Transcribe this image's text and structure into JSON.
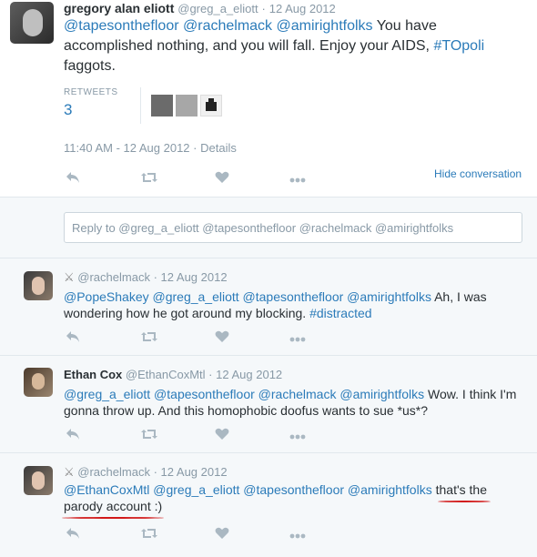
{
  "main_tweet": {
    "display_name": "gregory alan eliott",
    "handle": "@greg_a_eliott",
    "dot": "·",
    "date": "12 Aug 2012",
    "mentions": [
      "@tapesonthefloor",
      "@rachelmack",
      "@amirightfolks"
    ],
    "text_plain_1": "You have accomplished nothing, and you will fall. Enjoy your AIDS,",
    "hashtag": "#TOpoli",
    "text_plain_2": "faggots.",
    "retweets_label": "RETWEETS",
    "retweets_count": "3",
    "timestamp": "11:40 AM - 12 Aug 2012",
    "details_link": "Details",
    "hide_conversation": "Hide conversation"
  },
  "reply_box": {
    "placeholder": "Reply to @greg_a_eliott @tapesonthefloor @rachelmack @amirightfolks"
  },
  "replies": [
    {
      "handle": "@rachelmack",
      "date": "12 Aug 2012",
      "dot": "·",
      "line1_mentions": "@PopeShakey @greg_a_eliott @tapesonthefloor @amirightfolks",
      "line1_text": "Ah, I was",
      "line2_text": "wondering how he got around my blocking.",
      "line2_hashtag": "#distracted"
    },
    {
      "display_name": "Ethan Cox",
      "handle": "@EthanCoxMtl",
      "date": "12 Aug 2012",
      "dot": "·",
      "line1_mentions": "@greg_a_eliott @tapesonthefloor @rachelmack @amirightfolks",
      "line1_text": "Wow. I think I'm",
      "line2_text": "gonna throw up. And this homophobic doofus wants to sue *us*?"
    },
    {
      "handle": "@rachelmack",
      "date": "12 Aug 2012",
      "dot": "·",
      "line1_mentions": "@EthanCoxMtl @greg_a_eliott @tapesonthefloor @amirightfolks",
      "line1_text": "that's the",
      "line2_text": "parody account :)"
    }
  ],
  "colors": {
    "link": "#2b7bb9",
    "muted": "#8899a6",
    "icon": "#aab8c2",
    "bg_light": "#f5f8fa",
    "underline": "#d21919"
  }
}
